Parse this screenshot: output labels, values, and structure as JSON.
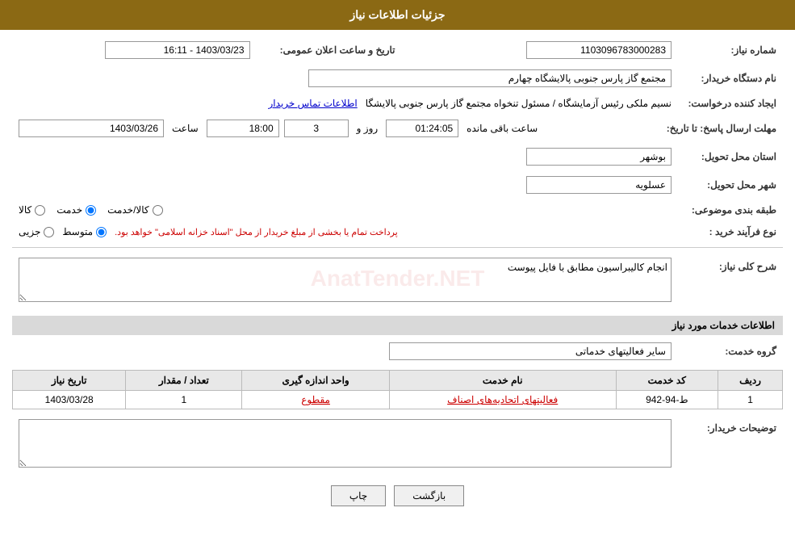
{
  "header": {
    "title": "جزئیات اطلاعات نیاز"
  },
  "fields": {
    "need_number_label": "شماره نیاز:",
    "need_number_value": "1103096783000283",
    "announcement_date_label": "تاریخ و ساعت اعلان عمومی:",
    "announcement_date_value": "1403/03/23 - 16:11",
    "buyer_org_label": "نام دستگاه خریدار:",
    "buyer_org_value": "مجتمع گاز پارس جنوبی  پالایشگاه چهارم",
    "creator_label": "ایجاد کننده درخواست:",
    "creator_value": "نسیم ملکی رئیس آزمایشگاه / مسئول تنخواه مجتمع گاز پارس جنوبی  پالایشگا",
    "creator_link": "اطلاعات تماس خریدار",
    "send_date_label": "مهلت ارسال پاسخ: تا تاریخ:",
    "send_date_date": "1403/03/26",
    "send_date_time_label": "ساعت",
    "send_date_time": "18:00",
    "send_date_day_label": "روز و",
    "send_date_day": "3",
    "send_date_remain_label": "ساعت باقی مانده",
    "send_date_remain": "01:24:05",
    "province_label": "استان محل تحویل:",
    "province_value": "بوشهر",
    "city_label": "شهر محل تحویل:",
    "city_value": "عسلویه",
    "category_label": "طبقه بندی موضوعی:",
    "category_options": [
      "کالا",
      "خدمت",
      "کالا/خدمت"
    ],
    "category_selected": "خدمت",
    "process_label": "نوع فرآیند خرید :",
    "process_options": [
      "جزیی",
      "متوسط"
    ],
    "process_note": "پرداخت تمام یا بخشی از مبلغ خریدار از محل \"اسناد خزانه اسلامی\" خواهد بود.",
    "description_label": "شرح کلی نیاز:",
    "description_value": "انجام کالیبراسیون مطابق با فایل پیوست",
    "services_section_title": "اطلاعات خدمات مورد نیاز",
    "service_group_label": "گروه خدمت:",
    "service_group_value": "سایر فعالیتهای خدماتی",
    "table": {
      "columns": [
        "ردیف",
        "کد خدمت",
        "نام خدمت",
        "واحد اندازه گیری",
        "تعداد / مقدار",
        "تاریخ نیاز"
      ],
      "rows": [
        {
          "row": "1",
          "code": "ط-94-942",
          "name": "فعالیتهای اتحادیه‌های اصناف",
          "unit": "مقطوع",
          "quantity": "1",
          "date": "1403/03/28"
        }
      ]
    },
    "buyer_desc_label": "توضیحات خریدار:",
    "buyer_desc_value": "",
    "btn_back": "بازگشت",
    "btn_print": "چاپ"
  }
}
